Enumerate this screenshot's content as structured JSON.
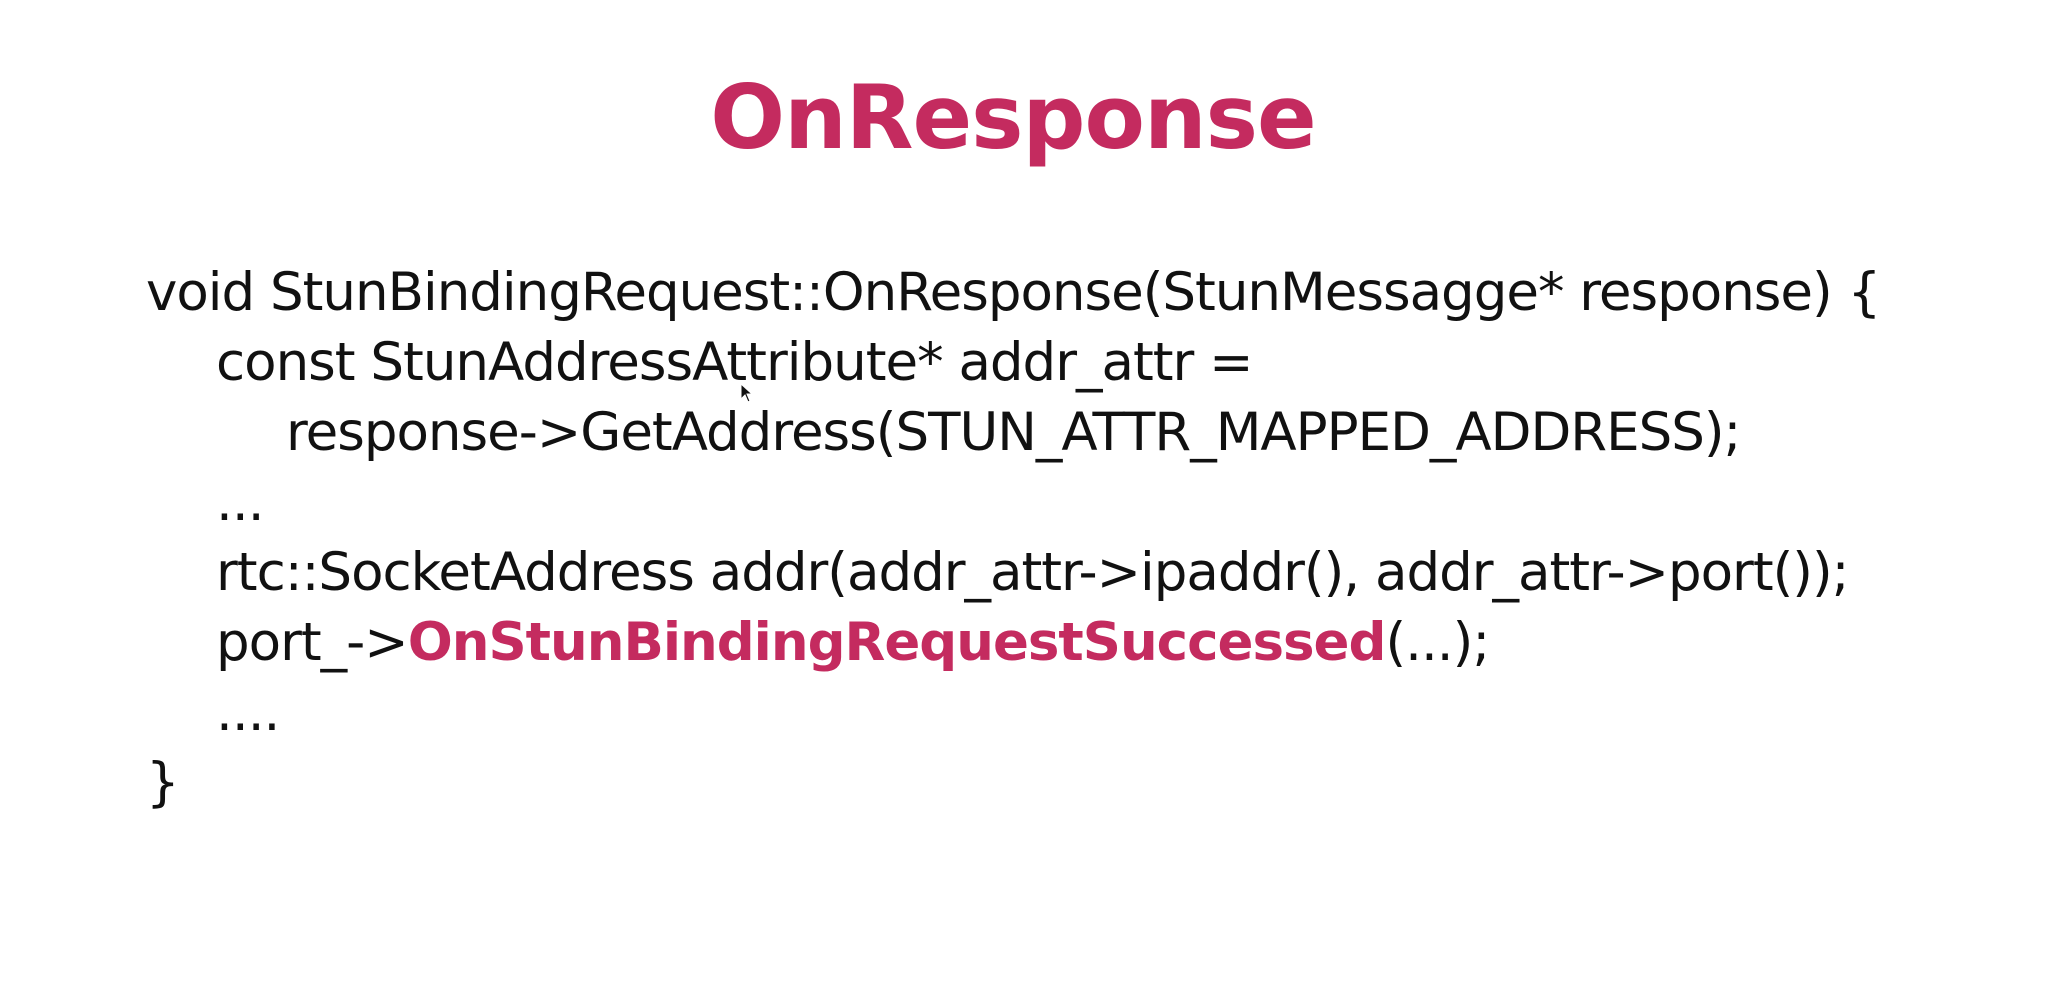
{
  "slide": {
    "title": "OnResponse",
    "accent_color": "#c42b5f",
    "text_color": "#111111",
    "background": "#ffffff"
  },
  "code": {
    "line1": "void StunBindingRequest::OnResponse(StunMessagge* response) {",
    "line2": "const StunAddressAttribute* addr_attr =",
    "line3": "response->GetAddress(STUN_ATTR_MAPPED_ADDRESS);",
    "line4": "...",
    "line5": "rtc::SocketAddress addr(addr_attr->ipaddr(), addr_attr->port());",
    "line6_prefix": "port_->",
    "line6_highlight": "OnStunBindingRequestSuccessed",
    "line6_suffix": "(...);",
    "line7": "....",
    "line8": "}"
  },
  "cursor": {
    "icon": "mouse-pointer-icon"
  }
}
